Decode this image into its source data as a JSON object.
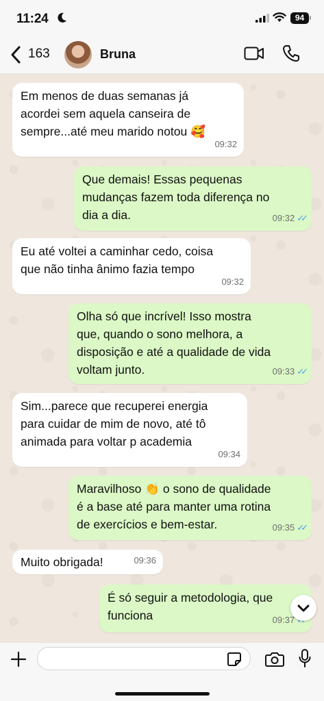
{
  "status_bar": {
    "time": "11:24",
    "battery": "94"
  },
  "header": {
    "back_count": "163",
    "contact_name": "Bruna"
  },
  "messages": [
    {
      "side": "in",
      "text": "Em menos de duas semanas já\nacordei sem aquela canseira de\nsempre...até meu marido notou 🥰",
      "time": "09:32"
    },
    {
      "side": "out",
      "text": "Que demais! Essas pequenas\nmudanças fazem toda diferença no\ndia a dia.",
      "time": "09:32"
    },
    {
      "side": "in",
      "text": "Eu até voltei a caminhar cedo, coisa\nque não tinha ânimo fazia tempo",
      "time": "09:32"
    },
    {
      "side": "out",
      "text": "Olha só que incrível! Isso mostra\nque, quando o sono melhora, a\ndisposição e até a qualidade de vida\nvoltam junto.",
      "time": "09:33"
    },
    {
      "side": "in",
      "text": "Sim...parece que recuperei energia\npara cuidar de mim de novo, até tô\nanimada para voltar p academia",
      "time": "09:34"
    },
    {
      "side": "out",
      "text": "Maravilhoso 👏 o sono de qualidade\né a base até para manter uma rotina\nde exercícios e bem-estar.",
      "time": "09:35"
    },
    {
      "side": "in",
      "text": "Muito obrigada!",
      "time": "09:36"
    },
    {
      "side": "out",
      "text": "É só seguir  a metodologia, que\nfunciona",
      "time": "09:37"
    }
  ],
  "input": {
    "placeholder": ""
  },
  "icons": {
    "back": "chevron-left-icon",
    "video": "video-camera-icon",
    "phone": "phone-icon",
    "plus": "plus-icon",
    "sticker": "sticker-icon",
    "camera": "camera-icon",
    "mic": "microphone-icon",
    "scroll": "chevron-down-icon"
  },
  "colors": {
    "incoming_bubble": "#ffffff",
    "outgoing_bubble": "#dbf8c6",
    "read_ticks": "#4fa3e6",
    "chat_background": "#efe7de"
  }
}
